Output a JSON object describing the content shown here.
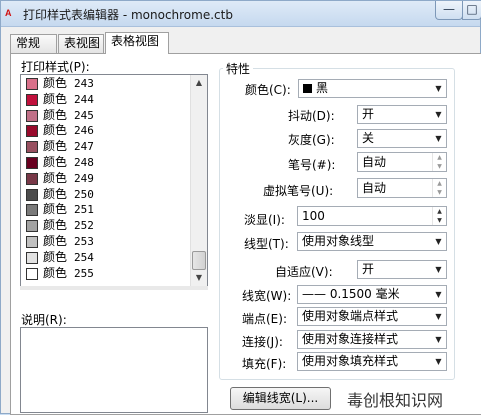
{
  "window": {
    "title": "打印样式表编辑器 - monochrome.ctb",
    "app_icon_label": "A",
    "minimize_glyph": "—",
    "maximize_glyph": "□"
  },
  "tabs": [
    {
      "label": "常规"
    },
    {
      "label": "表视图"
    },
    {
      "label": "表格视图"
    }
  ],
  "left": {
    "styles_label": "打印样式(P):",
    "description_label": "说明(R):",
    "description_value": "",
    "styles": [
      {
        "prefix": "颜色",
        "number": "243",
        "color": "#d8708a"
      },
      {
        "prefix": "颜色",
        "number": "244",
        "color": "#c0103c"
      },
      {
        "prefix": "颜色",
        "number": "245",
        "color": "#c07088"
      },
      {
        "prefix": "颜色",
        "number": "246",
        "color": "#980a2c"
      },
      {
        "prefix": "颜色",
        "number": "247",
        "color": "#985060"
      },
      {
        "prefix": "颜色",
        "number": "248",
        "color": "#680020"
      },
      {
        "prefix": "颜色",
        "number": "249",
        "color": "#783848"
      },
      {
        "prefix": "颜色",
        "number": "250",
        "color": "#4c4c4c"
      },
      {
        "prefix": "颜色",
        "number": "251",
        "color": "#7a7a7a"
      },
      {
        "prefix": "颜色",
        "number": "252",
        "color": "#a2a2a2"
      },
      {
        "prefix": "颜色",
        "number": "253",
        "color": "#c0c0c0"
      },
      {
        "prefix": "颜色",
        "number": "254",
        "color": "#e2e2e2"
      },
      {
        "prefix": "颜色",
        "number": "255",
        "color": "#ffffff"
      }
    ],
    "scroll_up": "▲",
    "scroll_down": "▼"
  },
  "props": {
    "group_title": "特性",
    "color": {
      "label": "颜色(C):",
      "value": "黑"
    },
    "dither": {
      "label": "抖动(D):",
      "value": "开"
    },
    "grayscale": {
      "label": "灰度(G):",
      "value": "关"
    },
    "pen": {
      "label": "笔号(#):",
      "value": "自动"
    },
    "virtual_pen": {
      "label": "虚拟笔号(U):",
      "value": "自动"
    },
    "screening": {
      "label": "淡显(I):",
      "value": "100"
    },
    "linetype": {
      "label": "线型(T):",
      "value": "使用对象线型"
    },
    "adaptive": {
      "label": "自适应(V):",
      "value": "开"
    },
    "lineweight": {
      "label": "线宽(W):",
      "value": "—— 0.1500 毫米"
    },
    "endstyle": {
      "label": "端点(E):",
      "value": "使用对象端点样式"
    },
    "joinstyle": {
      "label": "连接(J):",
      "value": "使用对象连接样式"
    },
    "fillstyle": {
      "label": "填充(F):",
      "value": "使用对象填充样式"
    },
    "dropdown_glyph": "▼",
    "spin_up": "▲",
    "spin_down": "▼"
  },
  "buttons": {
    "edit_lineweights": "编辑线宽(L)..."
  },
  "watermark": "毒创根知识网"
}
